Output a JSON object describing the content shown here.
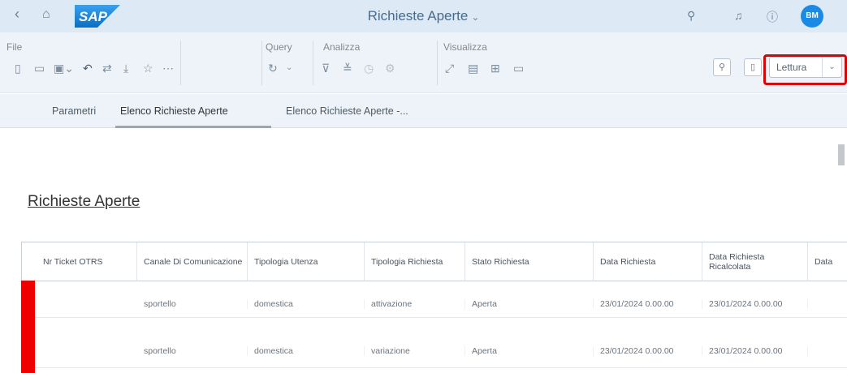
{
  "shell": {
    "title": "Richieste Aperte",
    "title_chevron": "⌄",
    "avatar": "BM",
    "icons": [
      "back-icon",
      "home-icon",
      "search-icon",
      "notifications-icon",
      "help-icon"
    ]
  },
  "toolbar": {
    "groups": {
      "file": "File",
      "query": "Query",
      "analizza": "Analizza",
      "visualizza": "Visualizza"
    },
    "mode_select": {
      "value": "Lettura"
    }
  },
  "tabs": [
    {
      "label": "Parametri"
    },
    {
      "label": "Elenco Richieste Aperte"
    },
    {
      "label": "Elenco Richieste Aperte -..."
    }
  ],
  "report": {
    "title": "Richieste Aperte",
    "columns": [
      "Nr Ticket OTRS",
      "Canale Di Comunicazione",
      "Tipologia Utenza",
      "Tipologia Richiesta",
      "Stato Richiesta",
      "Data Richiesta",
      "Data Richiesta Ricalcolata",
      "Data"
    ],
    "rows": [
      [
        "",
        "sportello",
        "domestica",
        "attivazione",
        "Aperta",
        "23/01/2024 0.00.00",
        "23/01/2024 0.00.00",
        ""
      ],
      [
        "",
        "sportello",
        "domestica",
        "variazione",
        "Aperta",
        "23/01/2024 0.00.00",
        "23/01/2024 0.00.00",
        ""
      ]
    ]
  },
  "colors": {
    "shell_bg": "#dde9f5",
    "highlight": "#e00000",
    "status_bar": "#ee0000",
    "avatar": "#1a8ae6"
  }
}
